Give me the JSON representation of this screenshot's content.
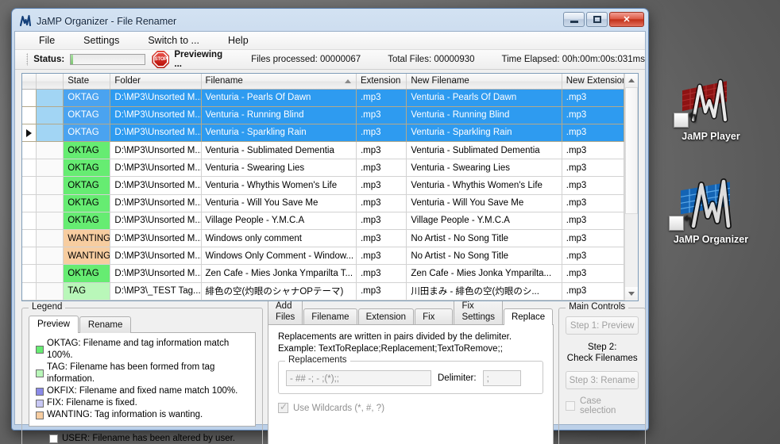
{
  "window": {
    "title": "JaMP Organizer - File Renamer",
    "app_icon": "jamp-waveform-icon",
    "buttons": {
      "minimize": "minimize-icon",
      "maximize": "maximize-icon",
      "close": "✕"
    }
  },
  "menu": {
    "items": [
      "File",
      "Settings",
      "Switch to ...",
      "Help"
    ]
  },
  "status": {
    "label": "Status:",
    "stop_icon_text": "STOP",
    "action": "Previewing ...",
    "files_processed": "Files processed: 00000067",
    "total_files": "Total Files: 00000930",
    "time_elapsed": "Time Elapsed: 00h:00m:00s:031ms"
  },
  "grid": {
    "columns": [
      "State",
      "Folder",
      "Filename",
      "Extension",
      "New Filename",
      "New Extension"
    ],
    "sorted_column": "Filename",
    "sort_direction": "asc",
    "rows": [
      {
        "selected": true,
        "marker": false,
        "state": "OKTAG",
        "state_color": "#4aa3f0",
        "folder": "D:\\MP3\\Unsorted M...",
        "filename": "Venturia - Pearls Of Dawn",
        "ext": ".mp3",
        "new_filename": "Venturia - Pearls Of Dawn",
        "new_ext": ".mp3"
      },
      {
        "selected": true,
        "marker": false,
        "state": "OKTAG",
        "state_color": "#4aa3f0",
        "folder": "D:\\MP3\\Unsorted M...",
        "filename": "Venturia - Running Blind",
        "ext": ".mp3",
        "new_filename": "Venturia - Running Blind",
        "new_ext": ".mp3"
      },
      {
        "selected": true,
        "marker": true,
        "state": "OKTAG",
        "state_color": "#4aa3f0",
        "folder": "D:\\MP3\\Unsorted M...",
        "filename": "Venturia - Sparkling Rain",
        "ext": ".mp3",
        "new_filename": "Venturia - Sparkling Rain",
        "new_ext": ".mp3"
      },
      {
        "selected": false,
        "marker": false,
        "state": "OKTAG",
        "state_color": "#66ec72",
        "folder": "D:\\MP3\\Unsorted M...",
        "filename": "Venturia - Sublimated Dementia",
        "ext": ".mp3",
        "new_filename": "Venturia - Sublimated Dementia",
        "new_ext": ".mp3"
      },
      {
        "selected": false,
        "marker": false,
        "state": "OKTAG",
        "state_color": "#66ec72",
        "folder": "D:\\MP3\\Unsorted M...",
        "filename": "Venturia - Swearing Lies",
        "ext": ".mp3",
        "new_filename": "Venturia - Swearing Lies",
        "new_ext": ".mp3"
      },
      {
        "selected": false,
        "marker": false,
        "state": "OKTAG",
        "state_color": "#66ec72",
        "folder": "D:\\MP3\\Unsorted M...",
        "filename": "Venturia - Whythis Women's Life",
        "ext": ".mp3",
        "new_filename": "Venturia - Whythis Women's Life",
        "new_ext": ".mp3"
      },
      {
        "selected": false,
        "marker": false,
        "state": "OKTAG",
        "state_color": "#66ec72",
        "folder": "D:\\MP3\\Unsorted M...",
        "filename": "Venturia - Will You Save Me",
        "ext": ".mp3",
        "new_filename": "Venturia - Will You Save Me",
        "new_ext": ".mp3"
      },
      {
        "selected": false,
        "marker": false,
        "state": "OKTAG",
        "state_color": "#66ec72",
        "folder": "D:\\MP3\\Unsorted M...",
        "filename": "Village People - Y.M.C.A",
        "ext": ".mp3",
        "new_filename": "Village People - Y.M.C.A",
        "new_ext": ".mp3"
      },
      {
        "selected": false,
        "marker": false,
        "state": "WANTING",
        "state_color": "#f7cda0",
        "folder": "D:\\MP3\\Unsorted M...",
        "filename": "Windows only comment",
        "ext": ".mp3",
        "new_filename": "No Artist - No Song Title",
        "new_ext": ".mp3"
      },
      {
        "selected": false,
        "marker": false,
        "state": "WANTING",
        "state_color": "#f7cda0",
        "folder": "D:\\MP3\\Unsorted M...",
        "filename": "Windows Only Comment - Window...",
        "ext": ".mp3",
        "new_filename": "No Artist - No Song Title",
        "new_ext": ".mp3"
      },
      {
        "selected": false,
        "marker": false,
        "state": "OKTAG",
        "state_color": "#66ec72",
        "folder": "D:\\MP3\\Unsorted M...",
        "filename": "Zen Cafe - Mies Jonka Ymparilta T...",
        "ext": ".mp3",
        "new_filename": "Zen Cafe - Mies Jonka Ymparilta...",
        "new_ext": ".mp3"
      },
      {
        "selected": false,
        "marker": false,
        "state": "TAG",
        "state_color": "#b9f7b9",
        "folder": "D:\\MP3\\_TEST Tag...",
        "filename": "緋色の空(灼眼のシャナOPテーマ)",
        "ext": ".mp3",
        "new_filename": "川田まみ - 緋色の空(灼眼のシ...",
        "new_ext": ".mp3"
      }
    ]
  },
  "legend": {
    "title": "Legend",
    "tabs": [
      {
        "label": "Preview",
        "active": true
      },
      {
        "label": "Rename",
        "active": false
      }
    ],
    "entries": [
      {
        "color": "#66ec72",
        "text": "OKTAG: Filename and tag information match 100%."
      },
      {
        "color": "#b9f7b9",
        "text": "TAG: Filename has been formed from tag information."
      },
      {
        "color": "#8a8ae8",
        "text": "OKFIX: Filename and fixed name match 100%."
      },
      {
        "color": "#c8c8f5",
        "text": "FIX: Filename is fixed."
      },
      {
        "color": "#f7cda0",
        "text": "WANTING: Tag information is wanting."
      }
    ],
    "user_entry": "USER: Filename has been altered by user."
  },
  "tabs_panel": {
    "tabs": [
      {
        "label": "Add Files",
        "active": false
      },
      {
        "label": "Filename",
        "active": false
      },
      {
        "label": "Extension",
        "active": false
      },
      {
        "label": "Fix",
        "active": false
      },
      {
        "label": "Fix Settings",
        "active": false
      },
      {
        "label": "Replace",
        "active": true
      }
    ],
    "replace": {
      "hint_line1": "Replacements are written in pairs divided by the delimiter.",
      "hint_line2": "Example: TextToReplace;Replacement;TextToRemove;;",
      "group_title": "Replacements",
      "replacements_value": "- ## -; - ;(*);;",
      "delimiter_label": "Delimiter:",
      "delimiter_value": ";",
      "wildcards_label": "Use Wildcards (*, #, ?)",
      "wildcards_checked": true
    }
  },
  "main_controls": {
    "title": "Main Controls",
    "step1": "Step 1: Preview",
    "step2_line1": "Step 2:",
    "step2_line2": "Check Filenames",
    "step3": "Step 3: Rename",
    "case_selection": "Case selection"
  },
  "desktop": {
    "icons": [
      {
        "label": "JaMP Player",
        "icon": "jamp-player-icon"
      },
      {
        "label": "JaMP Organizer",
        "icon": "jamp-organizer-icon"
      }
    ]
  }
}
